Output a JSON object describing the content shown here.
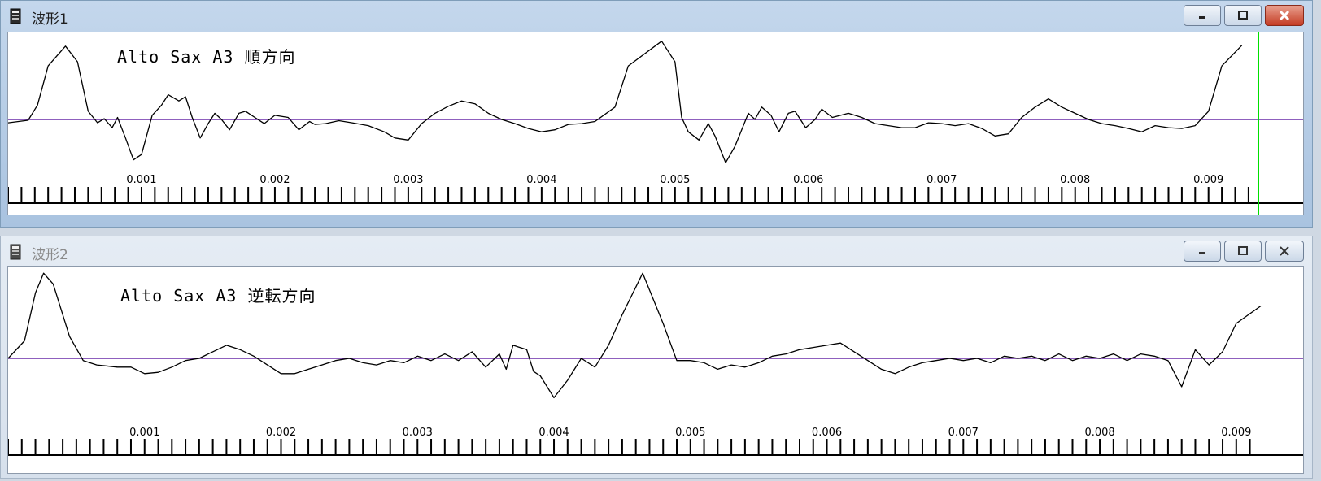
{
  "windows": [
    {
      "title": "波形1",
      "active": true,
      "chart_data": {
        "type": "line",
        "title": "Alto Sax A3 順方向",
        "xlim": [
          0.0,
          0.00938
        ],
        "x_ticks": [
          "0.001",
          "0.002",
          "0.003",
          "0.004",
          "0.005",
          "0.006",
          "0.007",
          "0.008",
          "0.009"
        ],
        "minor_tick_step": 0.0001,
        "baseline": 0,
        "ylim": [
          -1.1,
          1.9
        ],
        "colors": {
          "wave": "#000000",
          "baseline": "#6a2ca8",
          "edge_marker": "#00e000"
        },
        "series": [
          {
            "values": [
              [
                0.0,
                -0.08
              ],
              [
                0.00015,
                -0.02
              ],
              [
                0.00022,
                0.35
              ],
              [
                0.0003,
                1.3
              ],
              [
                0.00043,
                1.78
              ],
              [
                0.00052,
                1.4
              ],
              [
                0.0006,
                0.2
              ],
              [
                0.00067,
                -0.08
              ],
              [
                0.00072,
                0.02
              ],
              [
                0.00078,
                -0.2
              ],
              [
                0.00082,
                0.05
              ],
              [
                0.00088,
                -0.45
              ],
              [
                0.00094,
                -0.98
              ],
              [
                0.001,
                -0.85
              ],
              [
                0.00108,
                0.1
              ],
              [
                0.00115,
                0.35
              ],
              [
                0.0012,
                0.6
              ],
              [
                0.00128,
                0.45
              ],
              [
                0.00133,
                0.55
              ],
              [
                0.00138,
                0.05
              ],
              [
                0.00144,
                -0.45
              ],
              [
                0.0015,
                -0.1
              ],
              [
                0.00155,
                0.15
              ],
              [
                0.0016,
                0.0
              ],
              [
                0.00166,
                -0.25
              ],
              [
                0.00173,
                0.15
              ],
              [
                0.00178,
                0.2
              ],
              [
                0.00185,
                0.05
              ],
              [
                0.00192,
                -0.1
              ],
              [
                0.002,
                0.1
              ],
              [
                0.0021,
                0.05
              ],
              [
                0.00218,
                -0.25
              ],
              [
                0.00226,
                -0.05
              ],
              [
                0.0023,
                -0.12
              ],
              [
                0.00238,
                -0.1
              ],
              [
                0.00248,
                -0.03
              ],
              [
                0.00258,
                -0.08
              ],
              [
                0.0027,
                -0.15
              ],
              [
                0.00282,
                -0.3
              ],
              [
                0.0029,
                -0.45
              ],
              [
                0.003,
                -0.5
              ],
              [
                0.0031,
                -0.1
              ],
              [
                0.0032,
                0.15
              ],
              [
                0.0033,
                0.32
              ],
              [
                0.0034,
                0.45
              ],
              [
                0.0035,
                0.38
              ],
              [
                0.0036,
                0.15
              ],
              [
                0.0037,
                0.0
              ],
              [
                0.0038,
                -0.1
              ],
              [
                0.0039,
                -0.22
              ],
              [
                0.004,
                -0.3
              ],
              [
                0.0041,
                -0.25
              ],
              [
                0.0042,
                -0.12
              ],
              [
                0.0043,
                -0.1
              ],
              [
                0.0044,
                -0.05
              ],
              [
                0.00455,
                0.3
              ],
              [
                0.00465,
                1.3
              ],
              [
                0.0049,
                1.9
              ],
              [
                0.005,
                1.4
              ],
              [
                0.00505,
                0.05
              ],
              [
                0.0051,
                -0.3
              ],
              [
                0.00518,
                -0.5
              ],
              [
                0.00525,
                -0.1
              ],
              [
                0.0053,
                -0.4
              ],
              [
                0.00538,
                -1.05
              ],
              [
                0.00545,
                -0.65
              ],
              [
                0.0055,
                -0.25
              ],
              [
                0.00555,
                0.15
              ],
              [
                0.0056,
                0.0
              ],
              [
                0.00565,
                0.3
              ],
              [
                0.00572,
                0.1
              ],
              [
                0.00578,
                -0.3
              ],
              [
                0.00585,
                0.15
              ],
              [
                0.0059,
                0.2
              ],
              [
                0.00598,
                -0.2
              ],
              [
                0.00605,
                0.0
              ],
              [
                0.0061,
                0.25
              ],
              [
                0.00618,
                0.05
              ],
              [
                0.0063,
                0.15
              ],
              [
                0.0064,
                0.05
              ],
              [
                0.0065,
                -0.1
              ],
              [
                0.0066,
                -0.15
              ],
              [
                0.0067,
                -0.2
              ],
              [
                0.0068,
                -0.2
              ],
              [
                0.0069,
                -0.08
              ],
              [
                0.007,
                -0.1
              ],
              [
                0.0071,
                -0.15
              ],
              [
                0.0072,
                -0.1
              ],
              [
                0.0073,
                -0.22
              ],
              [
                0.0074,
                -0.4
              ],
              [
                0.0075,
                -0.35
              ],
              [
                0.0076,
                0.05
              ],
              [
                0.0077,
                0.3
              ],
              [
                0.0078,
                0.5
              ],
              [
                0.0079,
                0.3
              ],
              [
                0.008,
                0.15
              ],
              [
                0.0081,
                0.0
              ],
              [
                0.0082,
                -0.1
              ],
              [
                0.0083,
                -0.15
              ],
              [
                0.0084,
                -0.22
              ],
              [
                0.0085,
                -0.3
              ],
              [
                0.0086,
                -0.15
              ],
              [
                0.0087,
                -0.2
              ],
              [
                0.0088,
                -0.22
              ],
              [
                0.0089,
                -0.15
              ],
              [
                0.009,
                0.2
              ],
              [
                0.0091,
                1.3
              ],
              [
                0.00925,
                1.8
              ]
            ]
          }
        ]
      }
    },
    {
      "title": "波形2",
      "active": false,
      "chart_data": {
        "type": "line",
        "title": "Alto Sax A3 逆転方向",
        "xlim": [
          0.0,
          0.00918
        ],
        "x_ticks": [
          "0.001",
          "0.002",
          "0.003",
          "0.004",
          "0.005",
          "0.006",
          "0.007",
          "0.008",
          "0.009"
        ],
        "minor_tick_step": 0.0001,
        "baseline": 0,
        "ylim": [
          -1.2,
          2.0
        ],
        "colors": {
          "wave": "#000000",
          "baseline": "#6a2ca8"
        },
        "series": [
          {
            "values": [
              [
                0.0,
                0.0
              ],
              [
                0.00012,
                0.4
              ],
              [
                0.0002,
                1.5
              ],
              [
                0.00026,
                1.95
              ],
              [
                0.00033,
                1.7
              ],
              [
                0.00045,
                0.5
              ],
              [
                0.00055,
                -0.05
              ],
              [
                0.00065,
                -0.15
              ],
              [
                0.0008,
                -0.2
              ],
              [
                0.0009,
                -0.2
              ],
              [
                0.001,
                -0.35
              ],
              [
                0.0011,
                -0.32
              ],
              [
                0.0012,
                -0.2
              ],
              [
                0.0013,
                -0.05
              ],
              [
                0.0014,
                0.0
              ],
              [
                0.0015,
                0.15
              ],
              [
                0.0016,
                0.3
              ],
              [
                0.0017,
                0.2
              ],
              [
                0.0018,
                0.05
              ],
              [
                0.0019,
                -0.15
              ],
              [
                0.002,
                -0.35
              ],
              [
                0.0021,
                -0.35
              ],
              [
                0.0022,
                -0.25
              ],
              [
                0.0023,
                -0.15
              ],
              [
                0.0024,
                -0.05
              ],
              [
                0.0025,
                0.0
              ],
              [
                0.0026,
                -0.1
              ],
              [
                0.0027,
                -0.15
              ],
              [
                0.0028,
                -0.05
              ],
              [
                0.0029,
                -0.1
              ],
              [
                0.003,
                0.05
              ],
              [
                0.0031,
                -0.05
              ],
              [
                0.0032,
                0.1
              ],
              [
                0.0033,
                -0.05
              ],
              [
                0.0034,
                0.15
              ],
              [
                0.0035,
                -0.2
              ],
              [
                0.0036,
                0.1
              ],
              [
                0.00365,
                -0.25
              ],
              [
                0.0037,
                0.3
              ],
              [
                0.0038,
                0.2
              ],
              [
                0.00385,
                -0.3
              ],
              [
                0.0039,
                -0.4
              ],
              [
                0.004,
                -0.9
              ],
              [
                0.0041,
                -0.5
              ],
              [
                0.0042,
                0.0
              ],
              [
                0.0043,
                -0.2
              ],
              [
                0.0044,
                0.3
              ],
              [
                0.0045,
                1.0
              ],
              [
                0.00465,
                1.95
              ],
              [
                0.0048,
                0.8
              ],
              [
                0.0049,
                -0.05
              ],
              [
                0.005,
                -0.05
              ],
              [
                0.0051,
                -0.1
              ],
              [
                0.0052,
                -0.25
              ],
              [
                0.0053,
                -0.15
              ],
              [
                0.0054,
                -0.2
              ],
              [
                0.0055,
                -0.1
              ],
              [
                0.0056,
                0.05
              ],
              [
                0.0057,
                0.1
              ],
              [
                0.0058,
                0.2
              ],
              [
                0.0059,
                0.25
              ],
              [
                0.006,
                0.3
              ],
              [
                0.0061,
                0.35
              ],
              [
                0.0062,
                0.15
              ],
              [
                0.0063,
                -0.05
              ],
              [
                0.0064,
                -0.25
              ],
              [
                0.0065,
                -0.35
              ],
              [
                0.0066,
                -0.2
              ],
              [
                0.0067,
                -0.1
              ],
              [
                0.0068,
                -0.05
              ],
              [
                0.0069,
                0.0
              ],
              [
                0.007,
                -0.05
              ],
              [
                0.0071,
                0.0
              ],
              [
                0.0072,
                -0.1
              ],
              [
                0.0073,
                0.05
              ],
              [
                0.0074,
                0.0
              ],
              [
                0.0075,
                0.05
              ],
              [
                0.0076,
                -0.05
              ],
              [
                0.0077,
                0.1
              ],
              [
                0.0078,
                -0.05
              ],
              [
                0.0079,
                0.05
              ],
              [
                0.008,
                0.0
              ],
              [
                0.0081,
                0.1
              ],
              [
                0.0082,
                -0.05
              ],
              [
                0.0083,
                0.1
              ],
              [
                0.0084,
                0.05
              ],
              [
                0.0085,
                -0.05
              ],
              [
                0.0086,
                -0.65
              ],
              [
                0.0087,
                0.2
              ],
              [
                0.0088,
                -0.15
              ],
              [
                0.0089,
                0.15
              ],
              [
                0.009,
                0.8
              ],
              [
                0.00918,
                1.2
              ]
            ]
          }
        ]
      }
    }
  ]
}
